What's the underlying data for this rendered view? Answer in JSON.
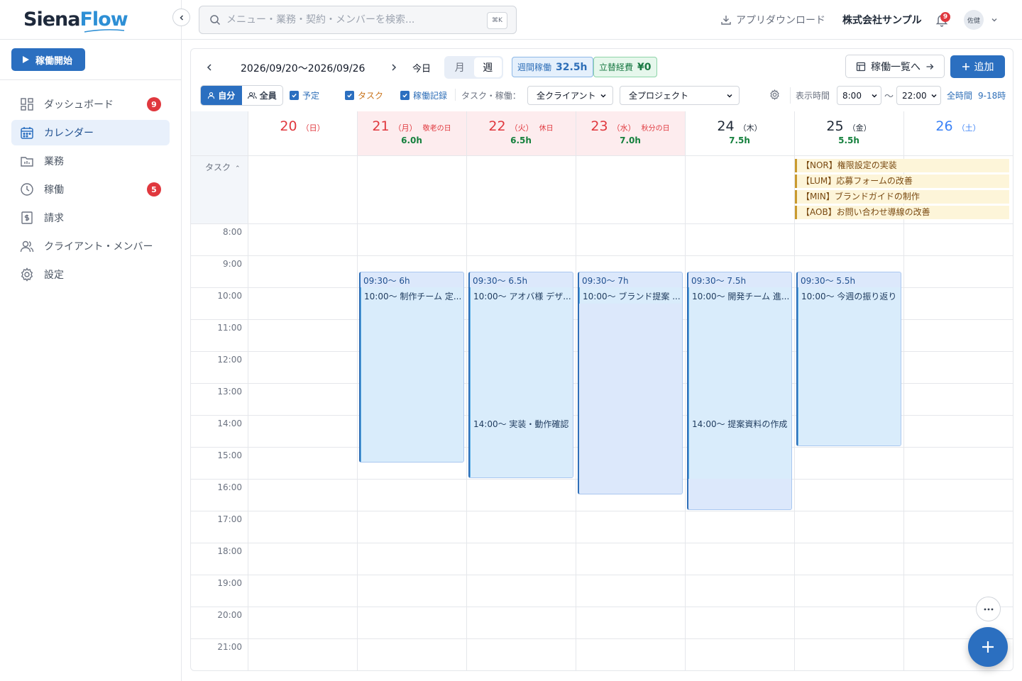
{
  "brand": {
    "part1": "Siena",
    "part2": "Flow"
  },
  "sidebar": {
    "start_label": "稼働開始",
    "items": [
      {
        "label": "ダッシュボード",
        "badge": "9"
      },
      {
        "label": "カレンダー",
        "badge": ""
      },
      {
        "label": "業務",
        "badge": ""
      },
      {
        "label": "稼働",
        "badge": "5"
      },
      {
        "label": "請求",
        "badge": ""
      },
      {
        "label": "クライアント・メンバー",
        "badge": ""
      },
      {
        "label": "設定",
        "badge": ""
      }
    ]
  },
  "topbar": {
    "search_placeholder": "メニュー・業務・契約・メンバーを検索...",
    "shortcut": "⌘K",
    "app_download": "アプリダウンロード",
    "company": "株式会社サンプル",
    "bell_count": "9",
    "avatar": "佐健"
  },
  "toolbar": {
    "date_range": "2026/09/20〜2026/09/26",
    "today": "今日",
    "view_month": "月",
    "view_week": "週",
    "weekly_label": "週間稼働",
    "weekly_value": "32.5h",
    "expense_label": "立替経費",
    "expense_value": "¥0",
    "list_btn": "稼働一覧へ",
    "add_btn": "追加",
    "scope_self": "自分",
    "scope_all": "全員",
    "chk_plan": "予定",
    "chk_task": "タスク",
    "chk_record": "稼働記録",
    "filter_label": "タスク・稼働：",
    "client_select": "全クライアント",
    "project_select": "全プロジェクト",
    "display_label": "表示時間",
    "time_from": "8:00",
    "tilde": "〜",
    "time_to": "22:00",
    "all_time": "全時間",
    "range_9_18": "9-18時"
  },
  "calendar": {
    "task_label": "タスク",
    "days": [
      {
        "num": "20",
        "wd": "（日）",
        "holiday": "",
        "hours": "",
        "color": "#e0383e",
        "bg": "#ffffff"
      },
      {
        "num": "21",
        "wd": "（月）",
        "holiday": "敬老の日",
        "hours": "6.0h",
        "color": "#e0383e",
        "bg": "#fdecee"
      },
      {
        "num": "22",
        "wd": "（火）",
        "holiday": "休日",
        "hours": "6.5h",
        "color": "#e0383e",
        "bg": "#fdecee"
      },
      {
        "num": "23",
        "wd": "（水）",
        "holiday": "秋分の日",
        "hours": "7.0h",
        "color": "#e0383e",
        "bg": "#fdecee"
      },
      {
        "num": "24",
        "wd": "（木）",
        "holiday": "",
        "hours": "7.5h",
        "color": "#1f2937",
        "bg": "#ffffff"
      },
      {
        "num": "25",
        "wd": "（金）",
        "holiday": "",
        "hours": "5.5h",
        "color": "#1f2937",
        "bg": "#ffffff"
      },
      {
        "num": "26",
        "wd": "（土）",
        "holiday": "",
        "hours": "",
        "color": "#3b82f6",
        "bg": "#ffffff"
      }
    ],
    "tasks": [
      "【NOR】権限設定の実装",
      "【LUM】応募フォームの改善",
      "【MIN】ブランドガイドの制作",
      "【AOB】お問い合わせ導線の改善"
    ],
    "times": [
      "8:00",
      "9:00",
      "10:00",
      "11:00",
      "12:00",
      "13:00",
      "14:00",
      "15:00",
      "16:00",
      "17:00",
      "18:00",
      "19:00",
      "20:00",
      "21:00"
    ],
    "events": [
      {
        "day": 1,
        "start": 9.5,
        "hours": 6,
        "title": "09:30〜 6h",
        "inner": [
          {
            "start": 10,
            "end": 15.5,
            "label": "10:00〜 制作チーム 定..."
          }
        ]
      },
      {
        "day": 2,
        "start": 9.5,
        "hours": 6.5,
        "title": "09:30〜 6.5h",
        "inner": [
          {
            "start": 10,
            "end": 14,
            "label": "10:00〜 アオバ様 デザ..."
          },
          {
            "start": 14,
            "end": 16,
            "label": "14:00〜 実装・動作確認"
          }
        ]
      },
      {
        "day": 3,
        "start": 9.5,
        "hours": 7,
        "title": "09:30〜 7h",
        "inner": [
          {
            "start": 10,
            "end": 10.5,
            "label": "10:00〜 ブランド提案 ..."
          }
        ]
      },
      {
        "day": 4,
        "start": 9.5,
        "hours": 7.5,
        "title": "09:30〜 7.5h",
        "inner": [
          {
            "start": 10,
            "end": 14,
            "label": "10:00〜 開発チーム 進..."
          },
          {
            "start": 14,
            "end": 16,
            "label": "14:00〜 提案資料の作成"
          }
        ]
      },
      {
        "day": 5,
        "start": 9.5,
        "hours": 5.5,
        "title": "09:30〜 5.5h",
        "inner": [
          {
            "start": 10,
            "end": 15,
            "label": "10:00〜 今週の振り返り"
          }
        ]
      }
    ]
  }
}
